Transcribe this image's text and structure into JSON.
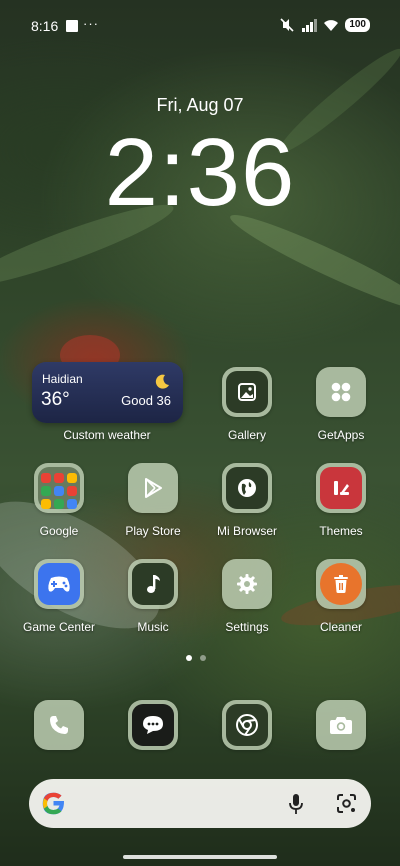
{
  "status_bar": {
    "time": "8:16",
    "more": "···",
    "battery": "100"
  },
  "lockclock": {
    "date": "Fri, Aug 07",
    "time": "2:36"
  },
  "weather_widget": {
    "location": "Haidian",
    "temperature": "36°",
    "air_quality": "Good 36",
    "label": "Custom weather"
  },
  "apps": {
    "gallery": "Gallery",
    "getapps": "GetApps",
    "google": "Google",
    "play_store": "Play Store",
    "mi_browser": "Mi Browser",
    "themes": "Themes",
    "game_center": "Game Center",
    "music": "Music",
    "settings": "Settings",
    "cleaner": "Cleaner"
  },
  "dock": [
    "phone-icon",
    "messages-icon",
    "chrome-icon",
    "camera-icon"
  ],
  "pages": {
    "count": 2,
    "current": 1
  },
  "colors": {
    "icon_glass": "#bccdb2",
    "icon_dark": "#2c3b26",
    "themes": "#c9363c",
    "cleaner": "#e8742c",
    "game_center": "#3c74ee",
    "weather_bg": "#2f3a66"
  }
}
